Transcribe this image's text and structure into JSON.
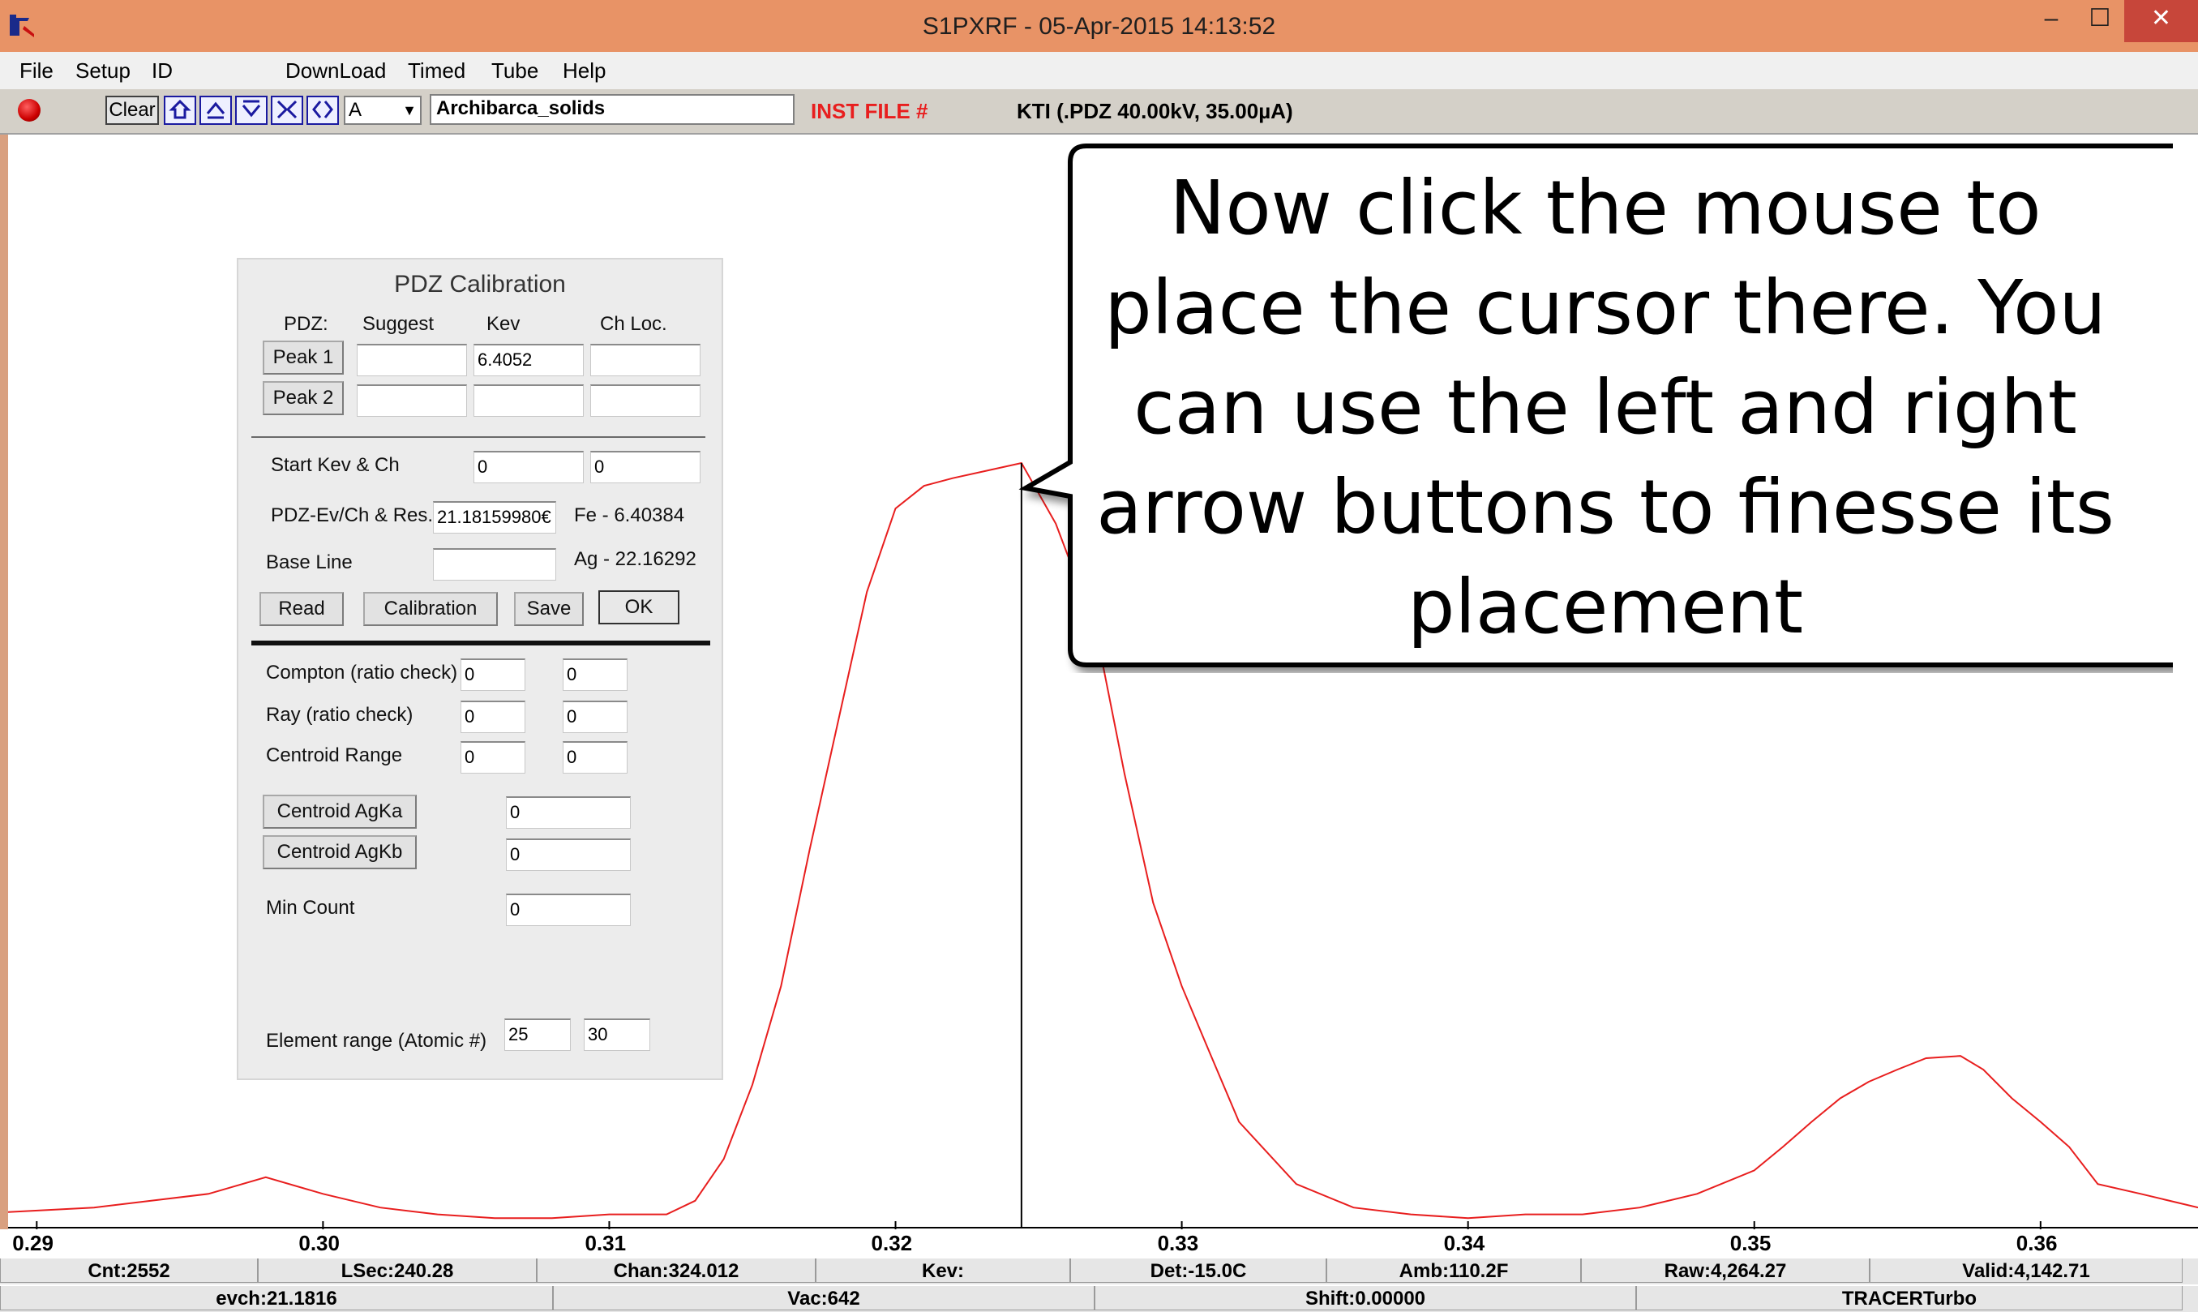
{
  "window": {
    "title": "S1PXRF - 05-Apr-2015 14:13:52",
    "minimize_glyph": "–",
    "maximize_glyph": "☐",
    "close_glyph": "✕",
    "app_icon": "s1pxrf-app-icon"
  },
  "menu": {
    "items": [
      "File",
      "Setup",
      "ID",
      "DownLoad",
      "Timed",
      "Tube",
      "Help"
    ]
  },
  "toolbar": {
    "clear_label": "Clear",
    "trace_select_value": "A",
    "sample_name": "Archibarca_solids",
    "inst_file_label": "INST FILE #",
    "tube_status": "KTI  (.PDZ 40.00kV, 35.00µA)",
    "icons": [
      "home-icon",
      "up-arrow-icon",
      "down-arrow-icon",
      "collapse-icon",
      "expand-icon"
    ],
    "accent_red": "#e81e1e"
  },
  "chart_data": {
    "type": "line",
    "xlabel": "",
    "ylabel": "",
    "xlim": [
      0.289,
      0.3655
    ],
    "ylim": [
      0,
      1
    ],
    "x_ticks": [
      "0.29",
      "0.30",
      "0.31",
      "0.32",
      "0.33",
      "0.34",
      "0.35",
      "0.36"
    ],
    "cursor_x": 0.3244,
    "series": [
      {
        "color": "#e81e1e",
        "x": [
          0.289,
          0.292,
          0.294,
          0.296,
          0.298,
          0.3,
          0.302,
          0.304,
          0.306,
          0.308,
          0.31,
          0.312,
          0.313,
          0.314,
          0.315,
          0.316,
          0.317,
          0.318,
          0.319,
          0.32,
          0.321,
          0.322,
          0.3232,
          0.3244,
          0.3256,
          0.327,
          0.328,
          0.329,
          0.33,
          0.331,
          0.332,
          0.334,
          0.336,
          0.338,
          0.34,
          0.342,
          0.344,
          0.346,
          0.348,
          0.35,
          0.351,
          0.352,
          0.353,
          0.354,
          0.355,
          0.356,
          0.3572,
          0.358,
          0.359,
          0.36,
          0.361,
          0.362,
          0.3635,
          0.3655
        ],
        "y": [
          0.012,
          0.018,
          0.027,
          0.036,
          0.058,
          0.036,
          0.018,
          0.009,
          0.004,
          0.004,
          0.009,
          0.009,
          0.027,
          0.082,
          0.18,
          0.31,
          0.49,
          0.66,
          0.83,
          0.94,
          0.97,
          0.98,
          0.99,
          1.0,
          0.92,
          0.78,
          0.59,
          0.42,
          0.31,
          0.22,
          0.131,
          0.049,
          0.018,
          0.009,
          0.004,
          0.009,
          0.009,
          0.018,
          0.036,
          0.067,
          0.098,
          0.131,
          0.162,
          0.184,
          0.2,
          0.215,
          0.218,
          0.2,
          0.162,
          0.131,
          0.098,
          0.049,
          0.036,
          0.018
        ]
      }
    ]
  },
  "status_bar_1": [
    "Cnt:2552",
    "LSec:240.28",
    "Chan:324.012",
    "Kev:",
    "Det:-15.0C",
    "Amb:110.2F",
    "Raw:4,264.27",
    "Valid:4,142.71"
  ],
  "status_bar_2": [
    "evch:21.1816",
    "Vac:642",
    "Shift:0.00000",
    "TRACERTurbo"
  ],
  "dialog": {
    "title": "PDZ Calibration",
    "col_pdz": "PDZ:",
    "col_suggest": "Suggest",
    "col_kev": "Kev",
    "col_chloc": "Ch Loc.",
    "peak1_label": "Peak 1",
    "peak2_label": "Peak 2",
    "peak1_suggest": "",
    "peak1_kev": "6.4052",
    "peak1_chloc": "",
    "peak2_suggest": "",
    "peak2_kev": "",
    "peak2_chloc": "",
    "start_kev_label": "Start Kev & Ch",
    "start_kev_value": "0",
    "start_ch_value": "0",
    "evch_label": "PDZ-Ev/Ch & Res.",
    "evch_value": "21.18159980€",
    "fe_label": "Fe - 6.40384",
    "baseline_label": "Base Line",
    "baseline_value": "",
    "ag_label": "Ag - 22.16292",
    "read_label": "Read",
    "calibration_label": "Calibration",
    "save_label": "Save",
    "ok_label": "OK",
    "compton_label": "Compton (ratio check)",
    "compton_a": "0",
    "compton_b": "0",
    "ray_label": "Ray (ratio check)",
    "ray_a": "0",
    "ray_b": "0",
    "centroid_range_label": "Centroid Range",
    "centroid_range_a": "0",
    "centroid_range_b": "0",
    "centroid_agka_label": "Centroid AgKa",
    "centroid_agka_value": "0",
    "centroid_agkb_label": "Centroid AgKb",
    "centroid_agkb_value": "0",
    "min_count_label": "Min Count",
    "min_count_value": "0",
    "element_range_label": "Element range (Atomic #)",
    "element_range_min": "25",
    "element_range_max": "30"
  },
  "callout": {
    "lines": [
      "Now click the mouse to",
      "place the cursor there. You",
      "can use the left and right",
      "arrow buttons to finesse its",
      "placement"
    ]
  }
}
